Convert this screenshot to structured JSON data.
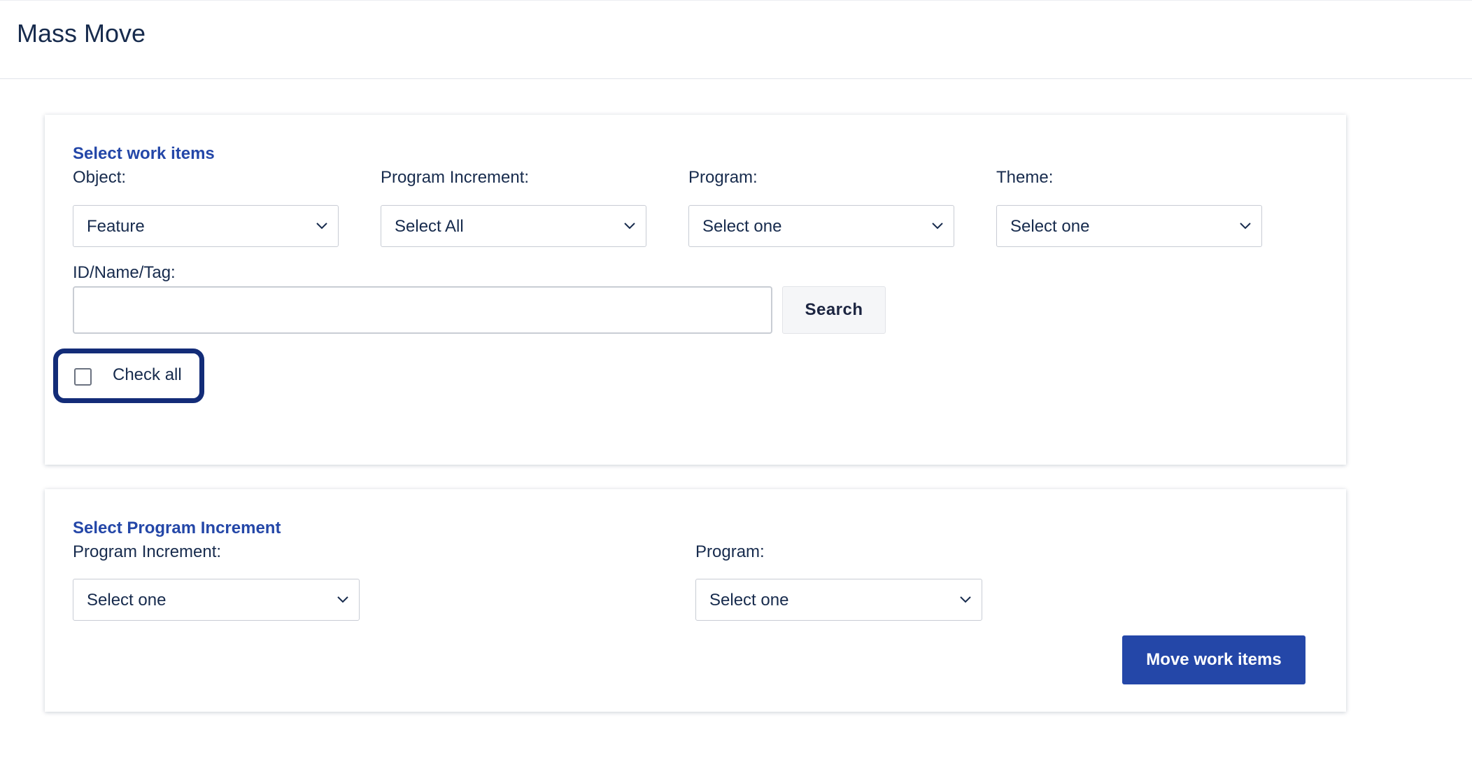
{
  "header": {
    "title": "Mass Move"
  },
  "work_items": {
    "section_title": "Select work items",
    "object": {
      "label": "Object:",
      "value": "Feature"
    },
    "program_increment": {
      "label": "Program Increment:",
      "value": "Select All"
    },
    "program": {
      "label": "Program:",
      "value": "Select one"
    },
    "theme": {
      "label": "Theme:",
      "value": "Select one"
    },
    "search": {
      "label": "ID/Name/Tag:",
      "value": "",
      "placeholder": "",
      "button_label": "Search"
    },
    "check_all": {
      "label": "Check all",
      "checked": false
    }
  },
  "target": {
    "section_title": "Select Program Increment",
    "program_increment": {
      "label": "Program Increment:",
      "value": "Select one"
    },
    "program": {
      "label": "Program:",
      "value": "Select one"
    },
    "move_button_label": "Move work items"
  },
  "colors": {
    "accent": "#2447a8",
    "focus_ring": "#132c78",
    "text": "#172b4d"
  },
  "icons": {
    "dropdown": "chevron-down-icon",
    "checkbox": "checkbox-icon"
  }
}
